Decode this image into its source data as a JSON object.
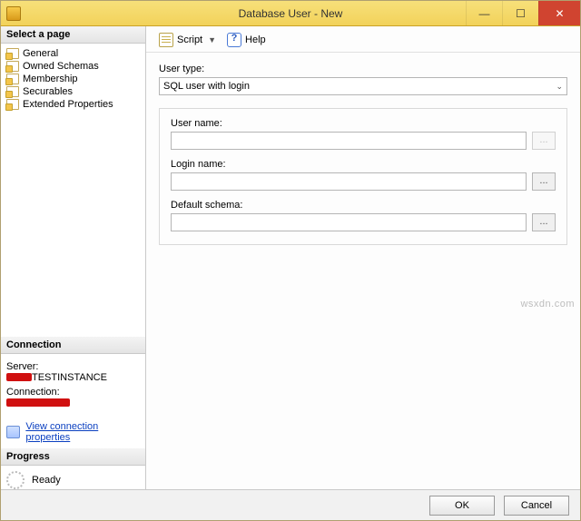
{
  "window": {
    "title": "Database User - New"
  },
  "sidebar": {
    "select_page_header": "Select a page",
    "pages": [
      {
        "label": "General"
      },
      {
        "label": "Owned Schemas"
      },
      {
        "label": "Membership"
      },
      {
        "label": "Securables"
      },
      {
        "label": "Extended Properties"
      }
    ],
    "connection_header": "Connection",
    "server_label": "Server:",
    "server_value_suffix": "TESTINSTANCE",
    "connection_label": "Connection:",
    "view_props_link": "View connection properties",
    "progress_header": "Progress",
    "progress_status": "Ready"
  },
  "toolbar": {
    "script_label": "Script",
    "help_label": "Help"
  },
  "form": {
    "user_type_label": "User type:",
    "user_type_value": "SQL user with login",
    "user_name_label": "User name:",
    "user_name_value": "",
    "login_name_label": "Login name:",
    "login_name_value": "",
    "default_schema_label": "Default schema:",
    "default_schema_value": "",
    "browse_label": "..."
  },
  "footer": {
    "ok": "OK",
    "cancel": "Cancel"
  },
  "watermark": "wsxdn.com"
}
